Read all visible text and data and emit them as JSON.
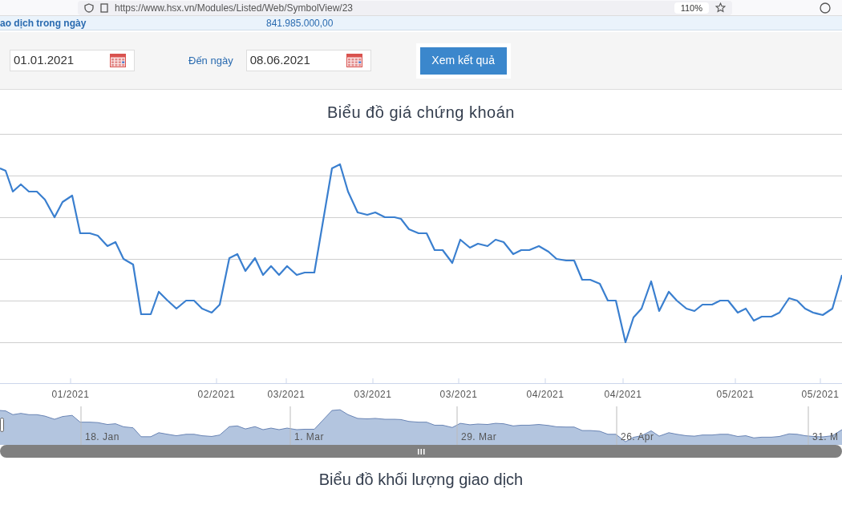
{
  "browser": {
    "url": "https://www.hsx.vn/Modules/Listed/Web/SymbolView/23",
    "zoom": "110%"
  },
  "info_strip": {
    "label": "ao dịch trong ngày",
    "value": "841.985.000,00"
  },
  "filters": {
    "from_date": "01.01.2021",
    "to_label": "Đến ngày",
    "to_date": "08.06.2021",
    "submit": "Xem kết quả"
  },
  "price_chart": {
    "title": "Biểu đồ giá chứng khoán",
    "x_labels": [
      "01/2021",
      "02/2021",
      "03/2021",
      "03/2021",
      "03/2021",
      "04/2021",
      "04/2021",
      "05/2021",
      "05/2021"
    ]
  },
  "navigator": {
    "labels": [
      "18. Jan",
      "1. Mar",
      "29. Mar",
      "26. Apr",
      "31. M"
    ]
  },
  "next_section": {
    "title": "Biểu đồ khối lượng giao dịch"
  }
}
